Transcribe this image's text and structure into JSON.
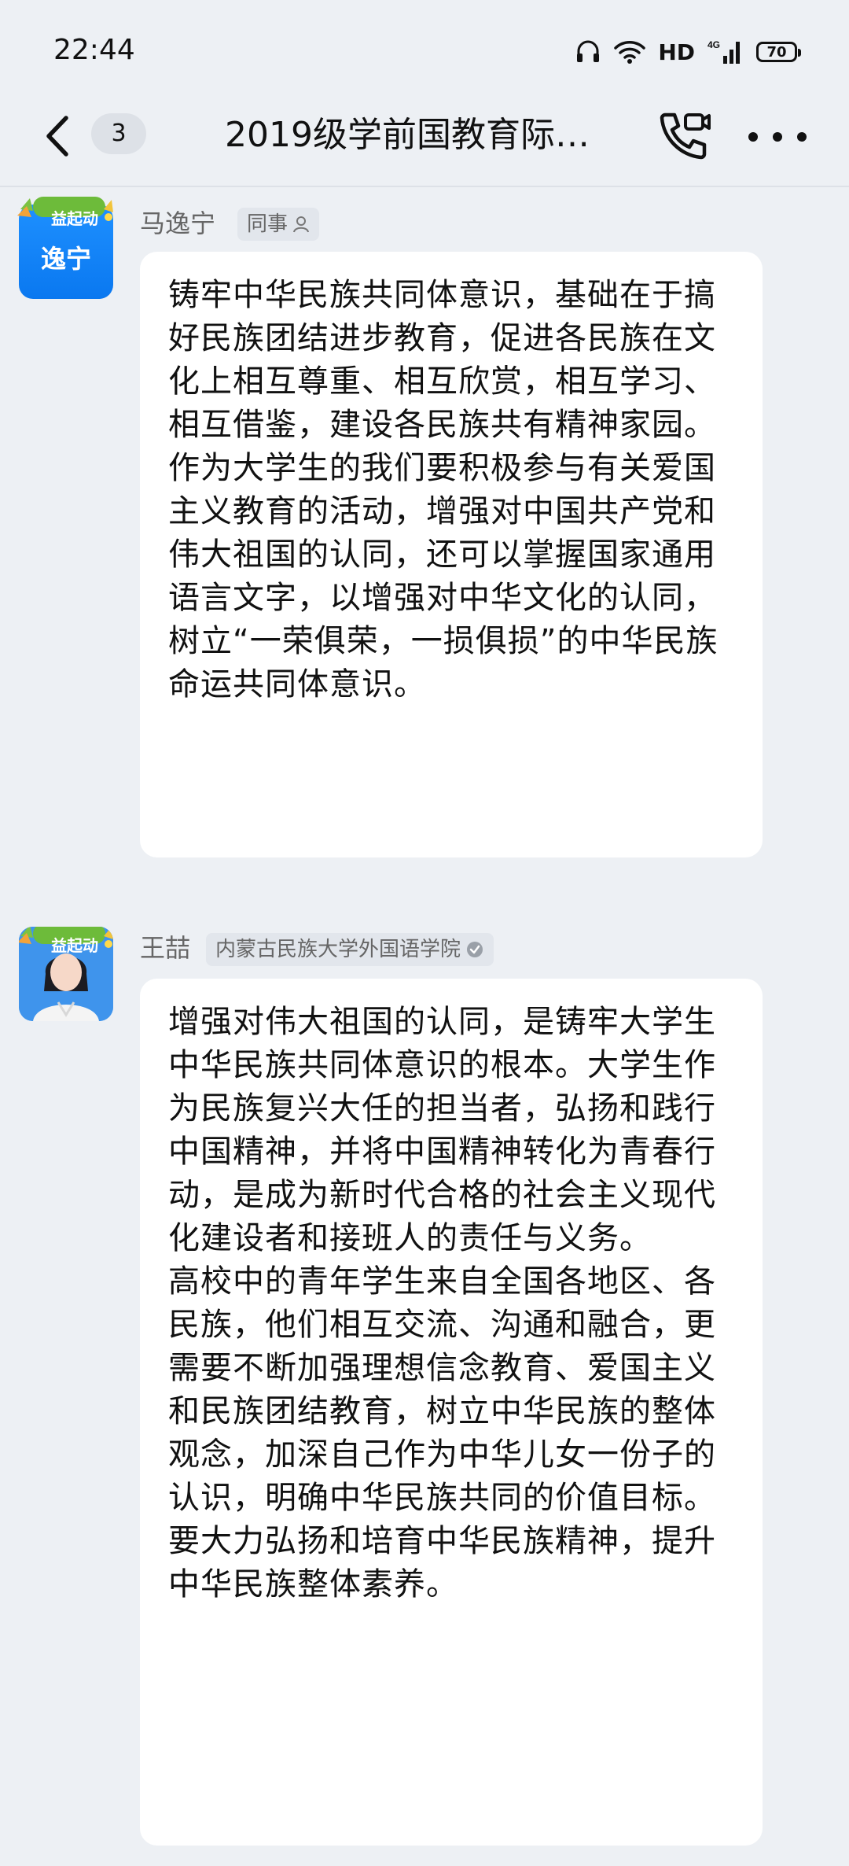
{
  "status_bar": {
    "time": "22:44",
    "network": "HD",
    "network_gen": "4G",
    "battery": "70"
  },
  "nav": {
    "unread_count": "3",
    "title": "2019级学前国教育际…"
  },
  "messages": [
    {
      "sender": "马逸宁",
      "tag": "同事",
      "avatar_text": "逸宁",
      "avatar_badge": "益起动",
      "text": "铸牢中华民族共同体意识，基础在于搞好民族团结进步教育，促进各民族在文化上相互尊重、相互欣赏，相互学习、相互借鉴，建设各民族共有精神家园。作为大学生的我们要积极参与有关爱国主义教育的活动，增强对中国共产党和伟大祖国的认同，还可以掌握国家通用语言文字，以增强对中华文化的认同，树立“一荣俱荣，一损俱损”的中华民族命运共同体意识。"
    },
    {
      "sender": "王喆",
      "tag": "内蒙古民族大学外国语学院",
      "avatar_badge": "益起动",
      "text": "增强对伟大祖国的认同，是铸牢大学生中华民族共同体意识的根本。大学生作为民族复兴大任的担当者，弘扬和践行中国精神，并将中国精神转化为青春行动，是成为新时代合格的社会主义现代化建设者和接班人的责任与义务。\n高校中的青年学生来自全国各地区、各民族，他们相互交流、沟通和融合，更需要不断加强理想信念教育、爱国主义和民族团结教育，树立中华民族的整体观念，加深自己作为中华儿女一份子的认识，明确中华民族共同的价值目标。要大力弘扬和培育中华民族精神，提升中华民族整体素养。"
    }
  ]
}
